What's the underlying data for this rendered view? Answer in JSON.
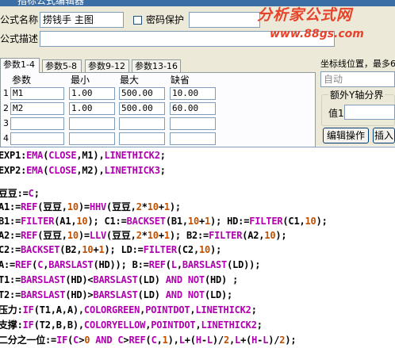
{
  "window": {
    "title": "指标公式编辑器"
  },
  "form": {
    "name_label": "公式名称",
    "name_value": "捞钱手 主图",
    "password_label": "密码保护",
    "desc_label": "公式描述",
    "desc_value": ""
  },
  "watermark": {
    "line1": "分析家公式网",
    "line2": "www.88gs.com"
  },
  "tabs": [
    "参数1-4",
    "参数5-8",
    "参数9-12",
    "参数13-16"
  ],
  "params": {
    "headers": [
      "参数",
      "最小",
      "最大",
      "缺省"
    ],
    "rows": [
      {
        "num": "1",
        "name": "M1",
        "min": "1.00",
        "max": "500.00",
        "def": "10.00"
      },
      {
        "num": "2",
        "name": "M2",
        "min": "1.00",
        "max": "500.00",
        "def": "60.00"
      },
      {
        "num": "3",
        "name": "",
        "min": "",
        "max": "",
        "def": ""
      },
      {
        "num": "4",
        "name": "",
        "min": "",
        "max": "",
        "def": ""
      }
    ]
  },
  "right_panel": {
    "coord_label": "坐标线位置，最多6",
    "coord_select": "自动",
    "extra_axis_label": "额外Y轴分界",
    "value1_label": "值1",
    "edit_button": "编辑操作",
    "insert_button": "插入"
  },
  "code": {
    "colors": {
      "identifier": "#000000",
      "function": "#b000b0",
      "number": "#c05000"
    },
    "lines": [
      [
        [
          "EXP1:",
          "id"
        ],
        [
          "EMA",
          "fn"
        ],
        [
          "(",
          "id"
        ],
        [
          "CLOSE",
          "fn"
        ],
        [
          ",M1),",
          "id"
        ],
        [
          "LINETHICK2",
          "fn"
        ],
        [
          ";",
          "id"
        ]
      ],
      [
        [
          "EXP2:",
          "id"
        ],
        [
          "EMA",
          "fn"
        ],
        [
          "(",
          "id"
        ],
        [
          "CLOSE",
          "fn"
        ],
        [
          ",M2),",
          "id"
        ],
        [
          "LINETHICK3",
          "fn"
        ],
        [
          ";",
          "id"
        ]
      ],
      [],
      [
        [
          "豆豆:=",
          "id"
        ],
        [
          "C",
          "fn"
        ],
        [
          ";",
          "id"
        ]
      ],
      [
        [
          "A1:=",
          "id"
        ],
        [
          "REF",
          "fn"
        ],
        [
          "(豆豆,",
          "id"
        ],
        [
          "10",
          "num"
        ],
        [
          ")=",
          "id"
        ],
        [
          "HHV",
          "fn"
        ],
        [
          "(豆豆,",
          "id"
        ],
        [
          "2",
          "num"
        ],
        [
          "*",
          "id"
        ],
        [
          "10",
          "num"
        ],
        [
          "+",
          "id"
        ],
        [
          "1",
          "num"
        ],
        [
          ");",
          "id"
        ]
      ],
      [
        [
          "B1:=",
          "id"
        ],
        [
          "FILTER",
          "fn"
        ],
        [
          "(A1,",
          "id"
        ],
        [
          "10",
          "num"
        ],
        [
          "); C1:=",
          "id"
        ],
        [
          "BACKSET",
          "fn"
        ],
        [
          "(B1,",
          "id"
        ],
        [
          "10",
          "num"
        ],
        [
          "+",
          "id"
        ],
        [
          "1",
          "num"
        ],
        [
          "); HD:=",
          "id"
        ],
        [
          "FILTER",
          "fn"
        ],
        [
          "(C1,",
          "id"
        ],
        [
          "10",
          "num"
        ],
        [
          ");",
          "id"
        ]
      ],
      [
        [
          "A2:=",
          "id"
        ],
        [
          "REF",
          "fn"
        ],
        [
          "(豆豆,",
          "id"
        ],
        [
          "10",
          "num"
        ],
        [
          ")=",
          "id"
        ],
        [
          "LLV",
          "fn"
        ],
        [
          "(豆豆,",
          "id"
        ],
        [
          "2",
          "num"
        ],
        [
          "*",
          "id"
        ],
        [
          "10",
          "num"
        ],
        [
          "+",
          "id"
        ],
        [
          "1",
          "num"
        ],
        [
          "); B2:=",
          "id"
        ],
        [
          "FILTER",
          "fn"
        ],
        [
          "(A2,",
          "id"
        ],
        [
          "10",
          "num"
        ],
        [
          ");",
          "id"
        ]
      ],
      [
        [
          "C2:=",
          "id"
        ],
        [
          "BACKSET",
          "fn"
        ],
        [
          "(B2,",
          "id"
        ],
        [
          "10",
          "num"
        ],
        [
          "+",
          "id"
        ],
        [
          "1",
          "num"
        ],
        [
          "); LD:=",
          "id"
        ],
        [
          "FILTER",
          "fn"
        ],
        [
          "(C2,",
          "id"
        ],
        [
          "10",
          "num"
        ],
        [
          ");",
          "id"
        ]
      ],
      [
        [
          "A:=",
          "id"
        ],
        [
          "REF",
          "fn"
        ],
        [
          "(",
          "id"
        ],
        [
          "C",
          "fn"
        ],
        [
          ",",
          "id"
        ],
        [
          "BARSLAST",
          "fn"
        ],
        [
          "(HD)); B:=",
          "id"
        ],
        [
          "REF",
          "fn"
        ],
        [
          "(",
          "id"
        ],
        [
          "L",
          "fn"
        ],
        [
          ",",
          "id"
        ],
        [
          "BARSLAST",
          "fn"
        ],
        [
          "(LD));",
          "id"
        ]
      ],
      [
        [
          "T1:=",
          "id"
        ],
        [
          "BARSLAST",
          "fn"
        ],
        [
          "(HD)<",
          "id"
        ],
        [
          "BARSLAST",
          "fn"
        ],
        [
          "(LD) ",
          "id"
        ],
        [
          "AND",
          "fn"
        ],
        [
          " ",
          "id"
        ],
        [
          "NOT",
          "fn"
        ],
        [
          "(HD) ;",
          "id"
        ]
      ],
      [
        [
          "T2:=",
          "id"
        ],
        [
          "BARSLAST",
          "fn"
        ],
        [
          "(HD)>",
          "id"
        ],
        [
          "BARSLAST",
          "fn"
        ],
        [
          "(LD) ",
          "id"
        ],
        [
          "AND",
          "fn"
        ],
        [
          " ",
          "id"
        ],
        [
          "NOT",
          "fn"
        ],
        [
          "(LD);",
          "id"
        ]
      ],
      [
        [
          "压力:",
          "id"
        ],
        [
          "IF",
          "fn"
        ],
        [
          "(T1,A,A),",
          "id"
        ],
        [
          "COLORGREEN",
          "fn"
        ],
        [
          ",",
          "id"
        ],
        [
          "POINTDOT",
          "fn"
        ],
        [
          ",",
          "id"
        ],
        [
          "LINETHICK2",
          "fn"
        ],
        [
          ";",
          "id"
        ]
      ],
      [
        [
          "支撑:",
          "id"
        ],
        [
          "IF",
          "fn"
        ],
        [
          "(T2,B,B),",
          "id"
        ],
        [
          "COLORYELLOW",
          "fn"
        ],
        [
          ",",
          "id"
        ],
        [
          "POINTDOT",
          "fn"
        ],
        [
          ",",
          "id"
        ],
        [
          "LINETHICK2",
          "fn"
        ],
        [
          ";",
          "id"
        ]
      ],
      [
        [
          "二分之一位:=",
          "id"
        ],
        [
          "IF",
          "fn"
        ],
        [
          "(",
          "id"
        ],
        [
          "C",
          "fn"
        ],
        [
          ">",
          "id"
        ],
        [
          "0",
          "num"
        ],
        [
          " ",
          "id"
        ],
        [
          "AND",
          "fn"
        ],
        [
          " ",
          "id"
        ],
        [
          "C",
          "fn"
        ],
        [
          ">",
          "id"
        ],
        [
          "REF",
          "fn"
        ],
        [
          "(",
          "id"
        ],
        [
          "C",
          "fn"
        ],
        [
          ",",
          "id"
        ],
        [
          "1",
          "num"
        ],
        [
          "),",
          "id"
        ],
        [
          "L",
          "fn"
        ],
        [
          "+(",
          "id"
        ],
        [
          "H",
          "fn"
        ],
        [
          "-",
          "id"
        ],
        [
          "L",
          "fn"
        ],
        [
          ")/",
          "id"
        ],
        [
          "2",
          "num"
        ],
        [
          ",",
          "id"
        ],
        [
          "L",
          "fn"
        ],
        [
          "+(",
          "id"
        ],
        [
          "H",
          "fn"
        ],
        [
          "-",
          "id"
        ],
        [
          "L",
          "fn"
        ],
        [
          ")/",
          "id"
        ],
        [
          "2",
          "num"
        ],
        [
          ");",
          "id"
        ]
      ]
    ]
  }
}
